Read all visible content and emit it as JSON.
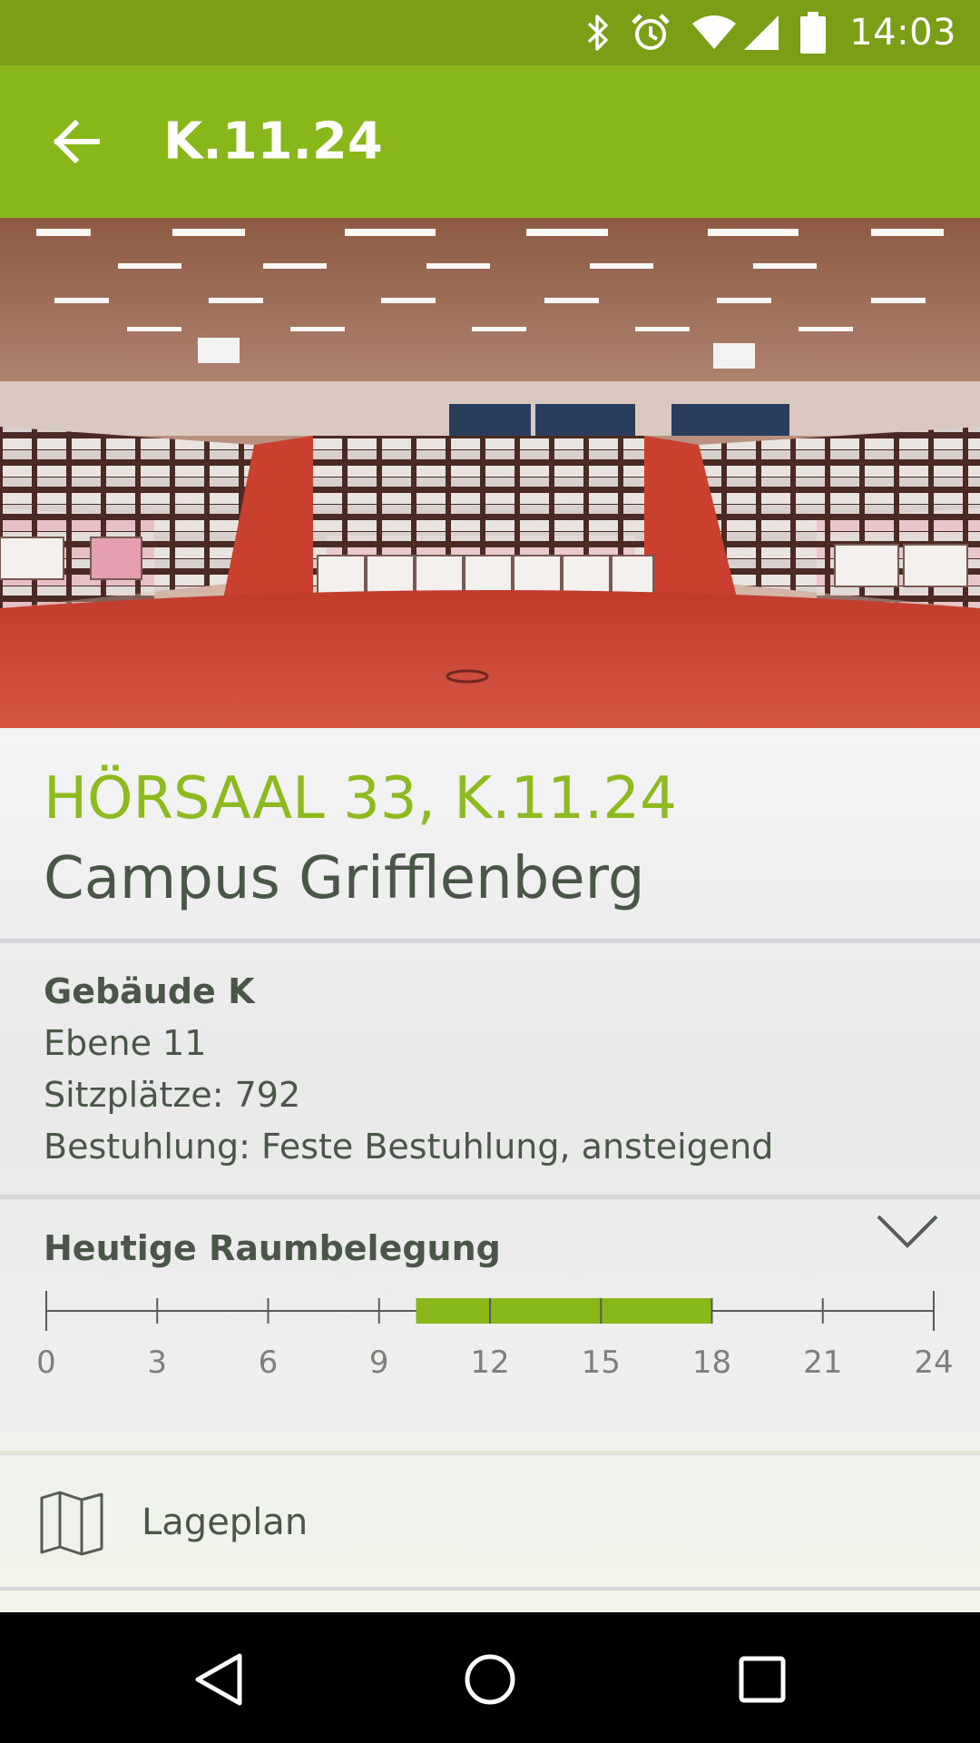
{
  "status_bar": {
    "time": "14:03",
    "icons": [
      "bluetooth-icon",
      "alarm-icon",
      "wifi-icon",
      "cell-signal-icon",
      "battery-icon"
    ]
  },
  "app_bar": {
    "title": "K.11.24",
    "back_icon": "arrow-back-icon",
    "color": "#88b719"
  },
  "room": {
    "title": "HÖRSAAL 33, K.11.24",
    "campus": "Campus Grifflenberg",
    "building": "Gebäude K",
    "level": "Ebene 11",
    "seats": "Sitzplätze: 792",
    "seating": "Bestuhlung: Feste Bestuhlung, ansteigend"
  },
  "occupancy": {
    "title": "Heutige Raumbelegung",
    "expand_icon": "chevron-down-icon",
    "ticks": [
      "0",
      "3",
      "6",
      "9",
      "12",
      "15",
      "18",
      "21",
      "24"
    ],
    "hour_range": [
      0,
      24
    ],
    "bookings": [
      [
        10,
        12
      ],
      [
        12,
        14
      ],
      [
        14,
        15
      ],
      [
        15,
        18
      ]
    ],
    "accent": "#88b719"
  },
  "actions": {
    "lageplan_label": "Lageplan",
    "lageplan_icon": "map-icon"
  },
  "nav_bar": {
    "back": "nav-back-icon",
    "home": "nav-home-icon",
    "recents": "nav-recents-icon"
  }
}
